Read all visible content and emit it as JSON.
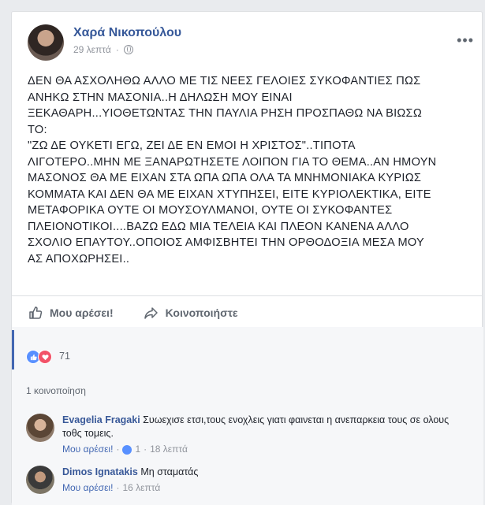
{
  "post": {
    "author": "Χαρά Νικοπούλου",
    "time": "29 λεπτά",
    "separator": "·",
    "text": "ΔΕΝ ΘΑ ΑΣΧΟΛΗΘΩ ΑΛΛΟ ΜΕ ΤΙΣ ΝΕΕΣ ΓΕΛΟΙΕΣ ΣΥΚΟΦΑΝΤΙΕΣ ΠΩΣ\nΑΝΗΚΩ ΣΤΗΝ ΜΑΣΟΝΙΑ..Η ΔΗΛΩΣΗ ΜΟΥ ΕΙΝΑΙ\nΞΕΚΑΘΑΡΗ...ΥΙΟΘΕΤΩΝΤΑΣ ΤΗΝ ΠΑΥΛΙΑ ΡΗΣΗ ΠΡΟΣΠΑΘΩ ΝΑ ΒΙΩΣΩ\nΤΟ:\n\"ΖΩ ΔΕ ΟΥΚΕΤΙ ΕΓΩ, ΖΕΙ ΔΕ ΕΝ ΕΜΟΙ Η ΧΡΙΣΤΟΣ\"..ΤΙΠΟΤΑ\nΛΙΓΟΤΕΡΟ..ΜΗΝ ΜΕ ΞΑΝΑΡΩΤΗΣΕΤΕ ΛΟΙΠΟΝ ΓΙΑ ΤΟ ΘΕΜΑ..ΑΝ ΗΜΟΥΝ\nΜΑΣΟΝΟΣ ΘΑ ΜΕ ΕΙΧΑΝ ΣΤΑ ΩΠΑ ΩΠΑ ΟΛΑ ΤΑ ΜΝΗΜΟΝΙΑΚΑ ΚΥΡΙΩΣ\nΚΟΜΜΑΤΑ ΚΑΙ ΔΕΝ ΘΑ ΜΕ ΕΙΧΑΝ ΧΤΥΠΗΣΕΙ, ΕΙΤΕ ΚΥΡΙΟΛΕΚΤΙΚΑ, ΕΙΤΕ\nΜΕΤΑΦΟΡΙΚΑ ΟΥΤΕ ΟΙ ΜΟΥΣΟΥΛΜΑΝΟΙ, ΟΥΤΕ ΟΙ ΣΥΚΟΦΑΝΤΕΣ\nΠΛΕΙΟΝΟΤΙΚΟΙ....ΒΑΖΩ ΕΔΩ ΜΙΑ ΤΕΛΕΙΑ ΚΑΙ ΠΛΕΟΝ ΚΑΝΕΝΑ ΑΛΛΟ\nΣΧΟΛΙΟ ΕΠΑΥΤΟΥ..ΟΠΟΙΟΣ ΑΜΦΙΣΒΗΤΕΙ ΤΗΝ ΟΡΘΟΔΟΞΙΑ ΜΕΣΑ ΜΟΥ\nΑΣ ΑΠΟΧΩΡΗΣΕΙ..",
    "more_icon": "ellipsis-icon",
    "privacy_icon": "globe-icon"
  },
  "actions": {
    "like_label": "Μου αρέσει!",
    "share_label": "Κοινοποιήστε"
  },
  "reactions": {
    "icons": [
      "like-icon",
      "love-icon"
    ],
    "count": "71"
  },
  "shares": {
    "label": "1 κοινοποίηση"
  },
  "comments": [
    {
      "name": "Evagelia Fragaki",
      "text": "Συωεχισε ετσι,τους ενοχλεις γιατι φαινεται η ανεπαρκεια τους σε ολους τοθς τομεις.",
      "like_label": "Μου αρέσει!",
      "separator": "·",
      "reaction_count": "1",
      "time": "18 λεπτά"
    },
    {
      "name": "Dimos Ignatakis",
      "text": "Μη σταματάς",
      "like_label": "Μου αρέσει!",
      "separator": "·",
      "time": "16 λεπτά"
    }
  ],
  "colors": {
    "link_blue": "#365899",
    "like_blue": "#5890ff",
    "love_red": "#f25268",
    "muted_gray": "#90949c",
    "background": "#e9ebee"
  }
}
